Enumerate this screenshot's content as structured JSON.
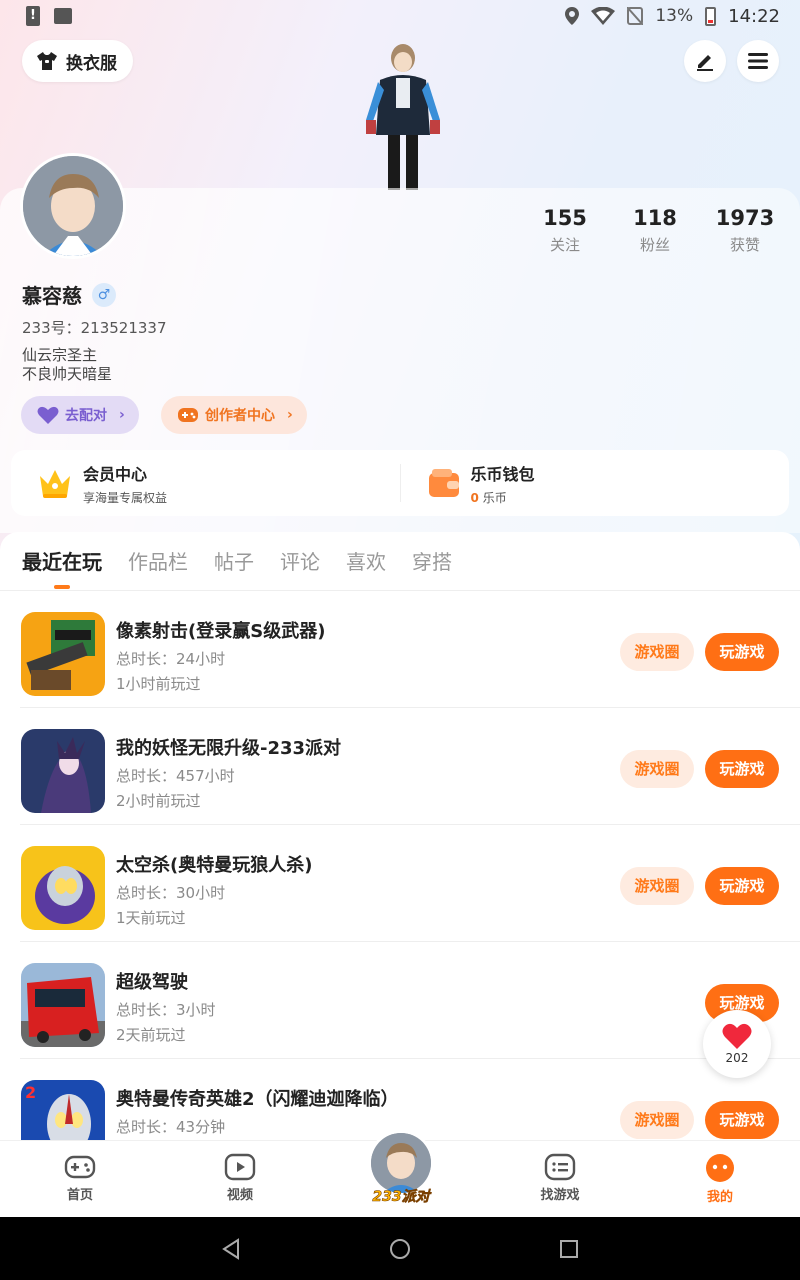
{
  "status_bar": {
    "battery": "13%",
    "time": "14:22"
  },
  "header": {
    "outfit_label": "换衣服"
  },
  "profile": {
    "stats": [
      {
        "value": "155",
        "label": "关注"
      },
      {
        "value": "118",
        "label": "粉丝"
      },
      {
        "value": "1973",
        "label": "获赞"
      }
    ],
    "username": "慕容慈",
    "gender_symbol": "♂",
    "uid": "233号：213521337",
    "bio_line1": "仙云宗圣主",
    "bio_line2": "不良帅天暗星",
    "match_label": "去配对",
    "creator_label": "创作者中心"
  },
  "member": {
    "vip_title": "会员中心",
    "vip_sub": "享海量专属权益",
    "wallet_title": "乐币钱包",
    "wallet_amount": "0",
    "wallet_unit": "乐币"
  },
  "tabs": [
    "最近在玩",
    "作品栏",
    "帖子",
    "评论",
    "喜欢",
    "穿搭"
  ],
  "games": [
    {
      "name": "像素射击(登录赢S级武器)",
      "duration": "总时长：24小时",
      "last_played": "1小时前玩过"
    },
    {
      "name": "我的妖怪无限升级-233派对",
      "duration": "总时长：457小时",
      "last_played": "2小时前玩过"
    },
    {
      "name": "太空杀(奥特曼玩狼人杀)",
      "duration": "总时长：30小时",
      "last_played": "1天前玩过"
    },
    {
      "name": "超级驾驶",
      "duration": "总时长：3小时",
      "last_played": "2天前玩过"
    },
    {
      "name": "奥特曼传奇英雄2（闪耀迪迦降临）",
      "duration": "总时长：43分钟",
      "last_played": ""
    }
  ],
  "game_buttons": {
    "circle": "游戏圈",
    "play": "玩游戏"
  },
  "float_like": {
    "count": "202"
  },
  "bottom_nav": {
    "home": "首页",
    "video": "视频",
    "center_brand": "233派对",
    "find_games": "找游戏",
    "mine": "我的"
  },
  "colors": {
    "accent": "#ff6f14",
    "accent_light": "#feebe0",
    "purple": "#7a5fd0"
  }
}
